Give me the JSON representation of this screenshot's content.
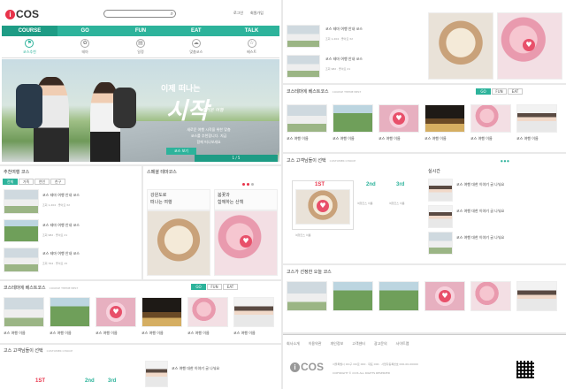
{
  "header": {
    "logo_text": "COS",
    "logo_letter": "i",
    "search": {
      "placeholder": "",
      "value": ""
    },
    "top_links": [
      "로그인",
      "회원가입"
    ]
  },
  "gnav": {
    "items": [
      "COURSE",
      "GO",
      "FUN",
      "EAT",
      "TALK"
    ],
    "active": 0
  },
  "subnav": {
    "items": [
      "코스추천",
      "테마",
      "일정",
      "맞춤코스",
      "베스트"
    ],
    "active": 0
  },
  "hero": {
    "kicker": "이제 떠나는",
    "title": "시작",
    "script": "즐거운 여행",
    "desc_lines": [
      "새로운 여행 시작을 위한 맞춤",
      "코스를 추천합니다. 지금",
      "함께 떠나보세요"
    ],
    "button": "코스 보기",
    "pager": "1 / 5"
  },
  "sec_recommend": {
    "title": "추천여행 코스",
    "tabs": [
      "전체",
      "가족",
      "연인",
      "친구"
    ],
    "items": [
      {
        "title": "코스 테마 여행 안내 코스",
        "meta": "조회 1,204 · 좋아요 32"
      },
      {
        "title": "코스 테마 여행 안내 코스",
        "meta": "조회 982 · 좋아요 21"
      },
      {
        "title": "코스 테마 여행 안내 코스",
        "meta": "조회 764 · 좋아요 15"
      }
    ]
  },
  "sec_special": {
    "title": "스페셜 테마코스",
    "card1": [
      "강원도로",
      "떠나는 여행"
    ],
    "card2": [
      "봄꽃과",
      "함께하는 산책"
    ]
  },
  "sec_gallery": {
    "title": "코스테마에 베스트코스",
    "subtitle": "COURSE THEME BEST",
    "tabs": [
      "GO",
      "FUN",
      "EAT"
    ],
    "captions": [
      "코스 여행 이름",
      "코스 여행 이름",
      "코스 여행 이름",
      "코스 여행 이름",
      "코스 여행 이름",
      "코스 여행 이름"
    ]
  },
  "sec_rank": {
    "title": "고스 고객님들이 선택",
    "subtitle": "CUSTOMER CHOICE",
    "first": "1ST",
    "second": "2nd",
    "third": "3rd",
    "labels": [
      "여행코스 이름",
      "여행코스 이름",
      "여행코스 이름"
    ]
  },
  "sec_talk": {
    "title": "실시간",
    "items": [
      "코스 여행 대한 이야기 글 나눠요",
      "코스 여행 대한 이야기 글 나눠요",
      "코스 여행 대한 이야기 글 나눠요"
    ]
  },
  "sec_mini": {
    "title": "고스가 선정한 오늘 코스"
  },
  "footer": {
    "logo_text": "COS",
    "logo_letter": "i",
    "links": [
      "회사소개",
      "이용약관",
      "개인정보",
      "고객센터",
      "광고문의",
      "사이트맵"
    ],
    "info": "서울특별시 OO구 OO로 000 · 대표 000 · 사업자등록번호 000-00-00000",
    "copyright": "COPYRIGHT © iCOS ALL RIGHTS RESERVED"
  },
  "colors": {
    "brand": "#2db39b",
    "accent": "#e8334a",
    "heart": "#e8506a"
  }
}
